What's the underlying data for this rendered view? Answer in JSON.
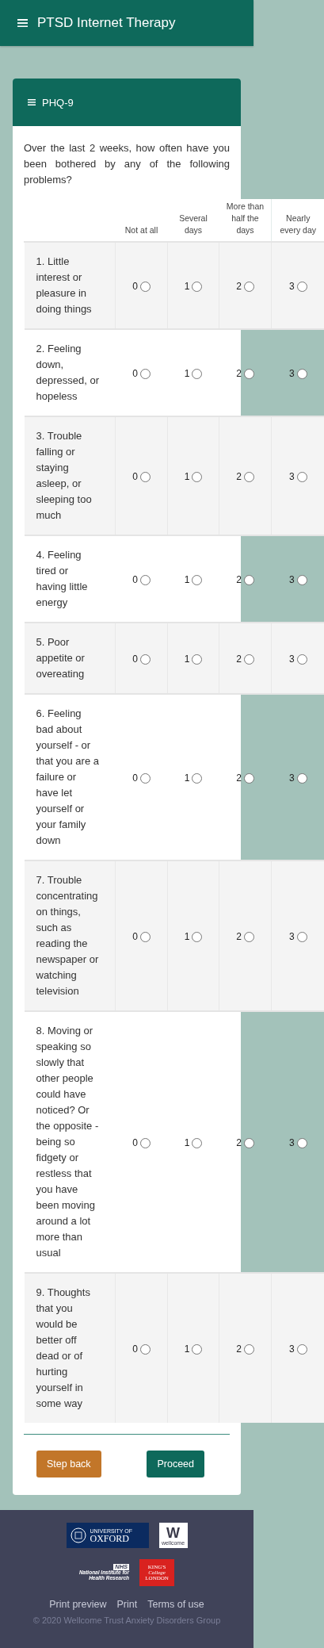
{
  "app_bar": {
    "title": "PTSD Internet Therapy"
  },
  "card": {
    "title": "PHQ-9",
    "intro": "Over the last 2 weeks, how often have you been bothered by any of the following problems?",
    "columns": [
      "Not at all",
      "Several days",
      "More than half the days",
      "Nearly every day"
    ],
    "items": [
      {
        "question": "1. Little interest or pleasure in doing things",
        "options": [
          {
            "label": "0",
            "selected": false
          },
          {
            "label": "1",
            "selected": false
          },
          {
            "label": "2",
            "selected": false
          },
          {
            "label": "3",
            "selected": false
          }
        ]
      },
      {
        "question": "2. Feeling down, depressed, or hopeless",
        "options": [
          {
            "label": "0",
            "selected": false
          },
          {
            "label": "1",
            "selected": false
          },
          {
            "label": "2",
            "selected": false
          },
          {
            "label": "3",
            "selected": false
          }
        ]
      },
      {
        "question": "3. Trouble falling or staying asleep, or sleeping too much",
        "options": [
          {
            "label": "0",
            "selected": false
          },
          {
            "label": "1",
            "selected": false
          },
          {
            "label": "2",
            "selected": false
          },
          {
            "label": "3",
            "selected": false
          }
        ]
      },
      {
        "question": "4. Feeling tired or having little energy",
        "options": [
          {
            "label": "0",
            "selected": false
          },
          {
            "label": "1",
            "selected": false
          },
          {
            "label": "2",
            "selected": false
          },
          {
            "label": "3",
            "selected": false
          }
        ]
      },
      {
        "question": "5. Poor appetite or overeating",
        "options": [
          {
            "label": "0",
            "selected": false
          },
          {
            "label": "1",
            "selected": false
          },
          {
            "label": "2",
            "selected": false
          },
          {
            "label": "3",
            "selected": false
          }
        ]
      },
      {
        "question": "6. Feeling bad about yourself - or that you are a failure or have let yourself or your family down",
        "options": [
          {
            "label": "0",
            "selected": false
          },
          {
            "label": "1",
            "selected": false
          },
          {
            "label": "2",
            "selected": false
          },
          {
            "label": "3",
            "selected": false
          }
        ]
      },
      {
        "question": "7. Trouble concentrating on things, such as reading the newspaper or watching television",
        "options": [
          {
            "label": "0",
            "selected": false
          },
          {
            "label": "1",
            "selected": false
          },
          {
            "label": "2",
            "selected": false
          },
          {
            "label": "3",
            "selected": false
          }
        ]
      },
      {
        "question": "8. Moving or speaking so slowly that other people could have noticed? Or the opposite - being so fidgety or restless that you have been moving around a lot more than usual",
        "options": [
          {
            "label": "0",
            "selected": false
          },
          {
            "label": "1",
            "selected": false
          },
          {
            "label": "2",
            "selected": false
          },
          {
            "label": "3",
            "selected": false
          }
        ]
      },
      {
        "question": "9. Thoughts that you would be better off dead or of hurting yourself in some way",
        "options": [
          {
            "label": "0",
            "selected": false
          },
          {
            "label": "1",
            "selected": false
          },
          {
            "label": "2",
            "selected": false
          },
          {
            "label": "3",
            "selected": false
          }
        ]
      }
    ],
    "buttons": [
      {
        "label": "Step back",
        "kind": "secondary"
      },
      {
        "label": "Proceed",
        "kind": "primary"
      }
    ]
  },
  "footer": {
    "logos": [
      {
        "kind": "oxford",
        "lines": [
          "UNIVERSITY OF",
          "OXFORD"
        ]
      },
      {
        "kind": "wellcome",
        "lines": [
          "W",
          "wellcome"
        ]
      },
      {
        "kind": "nihr",
        "lines": [
          "NHS",
          "National Institute for",
          "Health Research"
        ]
      },
      {
        "kind": "kings",
        "lines": [
          "KING'S",
          "College",
          "LONDON"
        ]
      }
    ],
    "links": [
      "Print preview",
      "Print",
      "Terms of use"
    ],
    "copyright": "© 2020 Wellcome Trust Anxiety Disorders Group"
  }
}
